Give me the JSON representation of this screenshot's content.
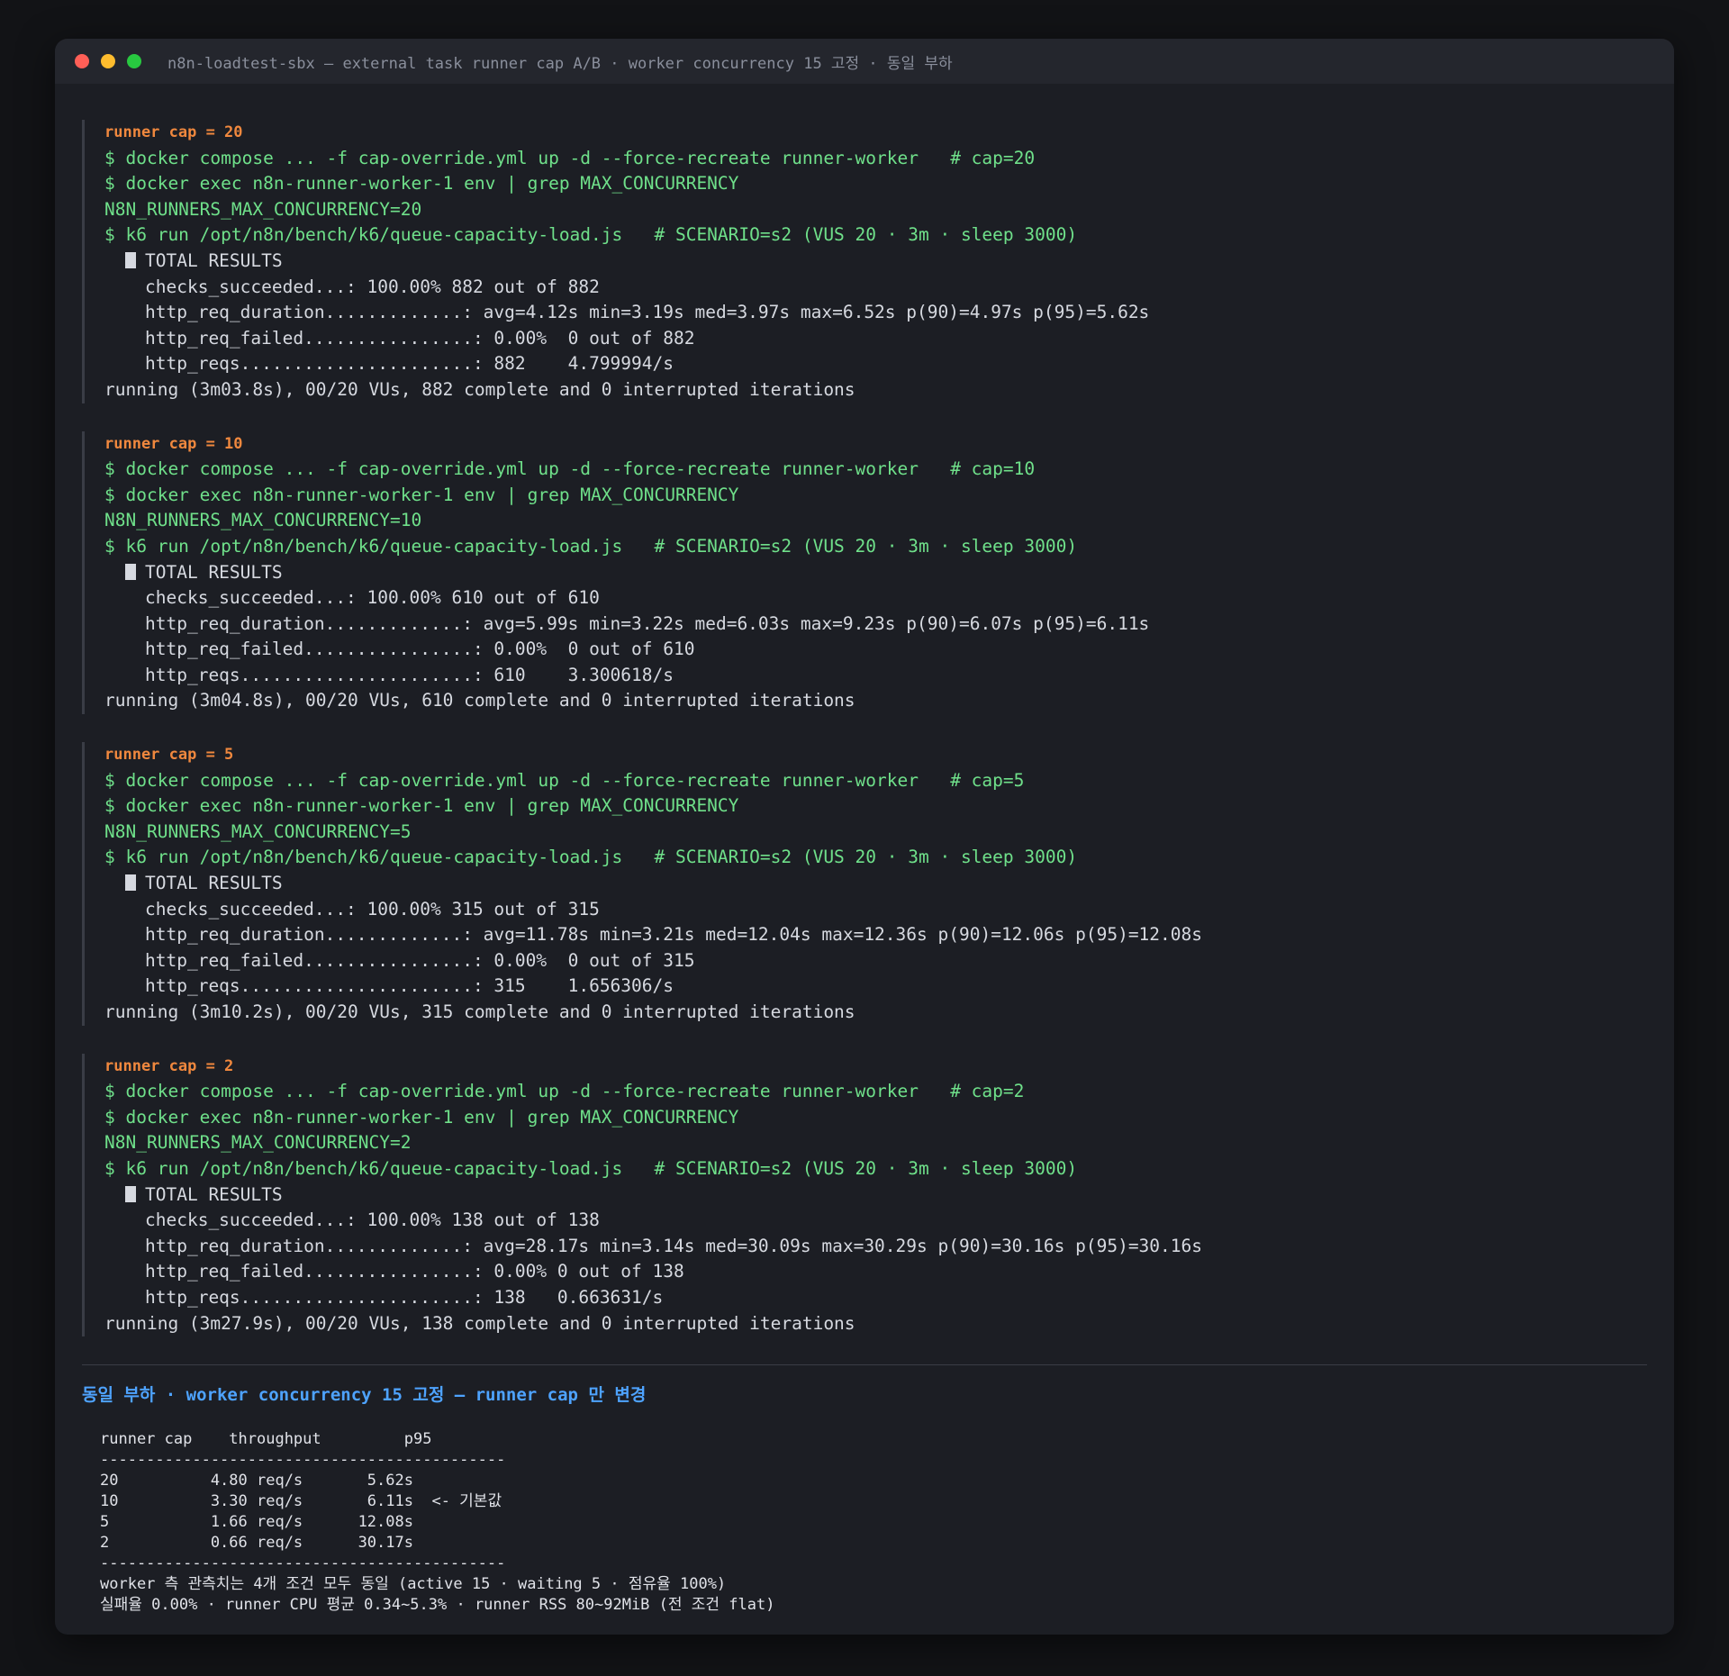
{
  "window": {
    "title": "n8n-loadtest-sbx — external task runner cap A/B · worker concurrency 15 고정 · 동일 부하"
  },
  "runs": [
    {
      "header": "runner cap = 20",
      "cmd_compose": "$ docker compose ... -f cap-override.yml up -d --force-recreate runner-worker   # cap=20",
      "cmd_exec": "$ docker exec n8n-runner-worker-1 env | grep MAX_CONCURRENCY",
      "env_out": "N8N_RUNNERS_MAX_CONCURRENCY=20",
      "cmd_k6": "$ k6 run /opt/n8n/bench/k6/queue-capacity-load.js   # SCENARIO=s2 (VUS 20 · 3m · sleep 3000)",
      "results_label": "TOTAL RESULTS",
      "checks": "checks_succeeded...: 100.00% 882 out of 882",
      "duration": "http_req_duration.............: avg=4.12s min=3.19s med=3.97s max=6.52s p(90)=4.97s p(95)=5.62s",
      "failed": "http_req_failed................: 0.00%  0 out of 882",
      "reqs": "http_reqs......................: 882    4.799994/s",
      "running": "running (3m03.8s), 00/20 VUs, 882 complete and 0 interrupted iterations"
    },
    {
      "header": "runner cap = 10",
      "cmd_compose": "$ docker compose ... -f cap-override.yml up -d --force-recreate runner-worker   # cap=10",
      "cmd_exec": "$ docker exec n8n-runner-worker-1 env | grep MAX_CONCURRENCY",
      "env_out": "N8N_RUNNERS_MAX_CONCURRENCY=10",
      "cmd_k6": "$ k6 run /opt/n8n/bench/k6/queue-capacity-load.js   # SCENARIO=s2 (VUS 20 · 3m · sleep 3000)",
      "results_label": "TOTAL RESULTS",
      "checks": "checks_succeeded...: 100.00% 610 out of 610",
      "duration": "http_req_duration.............: avg=5.99s min=3.22s med=6.03s max=9.23s p(90)=6.07s p(95)=6.11s",
      "failed": "http_req_failed................: 0.00%  0 out of 610",
      "reqs": "http_reqs......................: 610    3.300618/s",
      "running": "running (3m04.8s), 00/20 VUs, 610 complete and 0 interrupted iterations"
    },
    {
      "header": "runner cap = 5",
      "cmd_compose": "$ docker compose ... -f cap-override.yml up -d --force-recreate runner-worker   # cap=5",
      "cmd_exec": "$ docker exec n8n-runner-worker-1 env | grep MAX_CONCURRENCY",
      "env_out": "N8N_RUNNERS_MAX_CONCURRENCY=5",
      "cmd_k6": "$ k6 run /opt/n8n/bench/k6/queue-capacity-load.js   # SCENARIO=s2 (VUS 20 · 3m · sleep 3000)",
      "results_label": "TOTAL RESULTS",
      "checks": "checks_succeeded...: 100.00% 315 out of 315",
      "duration": "http_req_duration.............: avg=11.78s min=3.21s med=12.04s max=12.36s p(90)=12.06s p(95)=12.08s",
      "failed": "http_req_failed................: 0.00%  0 out of 315",
      "reqs": "http_reqs......................: 315    1.656306/s",
      "running": "running (3m10.2s), 00/20 VUs, 315 complete and 0 interrupted iterations"
    },
    {
      "header": "runner cap = 2",
      "cmd_compose": "$ docker compose ... -f cap-override.yml up -d --force-recreate runner-worker   # cap=2",
      "cmd_exec": "$ docker exec n8n-runner-worker-1 env | grep MAX_CONCURRENCY",
      "env_out": "N8N_RUNNERS_MAX_CONCURRENCY=2",
      "cmd_k6": "$ k6 run /opt/n8n/bench/k6/queue-capacity-load.js   # SCENARIO=s2 (VUS 20 · 3m · sleep 3000)",
      "results_label": "TOTAL RESULTS",
      "checks": "checks_succeeded...: 100.00% 138 out of 138",
      "duration": "http_req_duration.............: avg=28.17s min=3.14s med=30.09s max=30.29s p(90)=30.16s p(95)=30.16s",
      "failed": "http_req_failed................: 0.00% 0 out of 138",
      "reqs": "http_reqs......................: 138   0.663631/s",
      "running": "running (3m27.9s), 00/20 VUs, 138 complete and 0 interrupted iterations"
    }
  ],
  "summary": {
    "title": "동일 부하 · worker concurrency 15 고정 — runner cap 만 변경",
    "header_line": "runner cap    throughput         p95",
    "divider": "--------------------------------------------",
    "rows": [
      "20          4.80 req/s       5.62s",
      "10          3.30 req/s       6.11s  <- 기본값",
      "5           1.66 req/s      12.08s",
      "2           0.66 req/s      30.17s"
    ],
    "note1": "worker 측 관측치는 4개 조건 모두 동일 (active 15 · waiting 5 · 점유율 100%)",
    "note2": "실패율 0.00% · runner CPU 평균 0.34~5.3% · runner RSS 80~92MiB (전 조건 flat)"
  }
}
